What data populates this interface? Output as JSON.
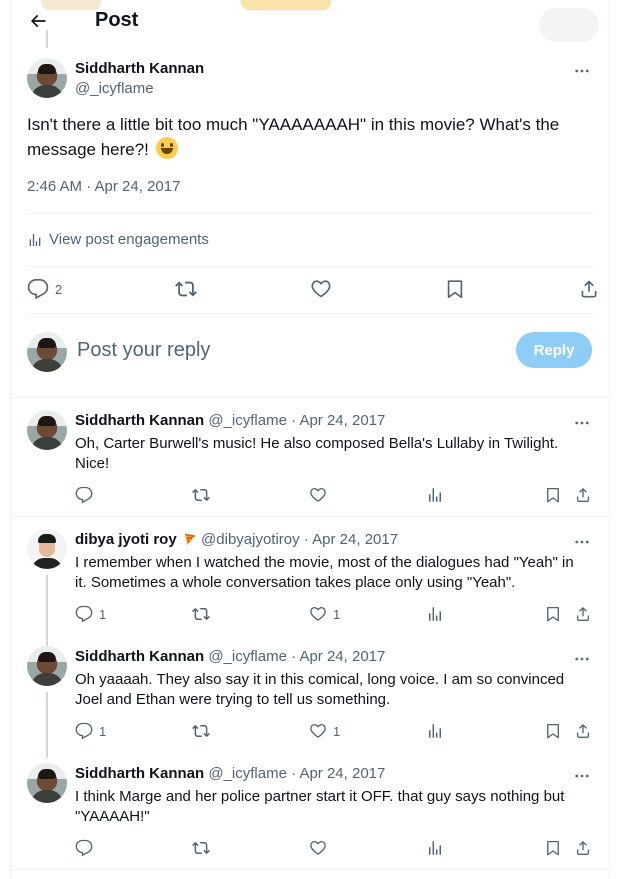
{
  "header": {
    "title": "Post",
    "back_label": "Back"
  },
  "colors": {
    "accent": "#1d9bf0",
    "reply_button_disabled": "#8ecdf8",
    "text_primary": "#0f1419",
    "text_secondary": "#536471",
    "divider": "#eff3f4"
  },
  "main_post": {
    "author_name": "Siddharth Kannan",
    "author_handle": "@_icyflame",
    "text": "Isn't there a little bit too much \"YAAAAAAAH\" in this movie? What's the message here?!",
    "emoji": "grinning-face",
    "timestamp": "2:46 AM · Apr 24, 2017",
    "engagements_label": "View post engagements",
    "reply_count": "2",
    "icons": [
      "reply-icon",
      "repost-icon",
      "like-icon",
      "bookmark-icon",
      "share-icon"
    ]
  },
  "compose": {
    "placeholder": "Post your reply",
    "button_label": "Reply"
  },
  "replies": [
    {
      "name": "Siddharth Kannan",
      "handle": "@_icyflame",
      "date": "Apr 24, 2017",
      "text": "Oh, Carter Burwell's music! He also composed Bella's Lullaby in Twilight. Nice!",
      "reply_count": "",
      "like_count": ""
    },
    {
      "name": "dibya jyoti roy",
      "name_emoji": "pizza",
      "handle": "@dibyajyotiroy",
      "date": "Apr 24, 2017",
      "text": "I remember when I watched the movie, most of the dialogues had \"Yeah\" in it. Sometimes a whole conversation takes place only using \"Yeah\".",
      "reply_count": "1",
      "like_count": "1"
    },
    {
      "name": "Siddharth Kannan",
      "handle": "@_icyflame",
      "date": "Apr 24, 2017",
      "text": "Oh yaaaah. They also say it in this comical, long voice. I am so convinced Joel and Ethan were trying to tell us something.",
      "reply_count": "1",
      "like_count": "1"
    },
    {
      "name": "Siddharth Kannan",
      "handle": "@_icyflame",
      "date": "Apr 24, 2017",
      "text": "I think Marge and her police partner start it OFF. that guy says nothing but \"YAAAAH!\"",
      "reply_count": "",
      "like_count": ""
    }
  ],
  "separator": "·"
}
